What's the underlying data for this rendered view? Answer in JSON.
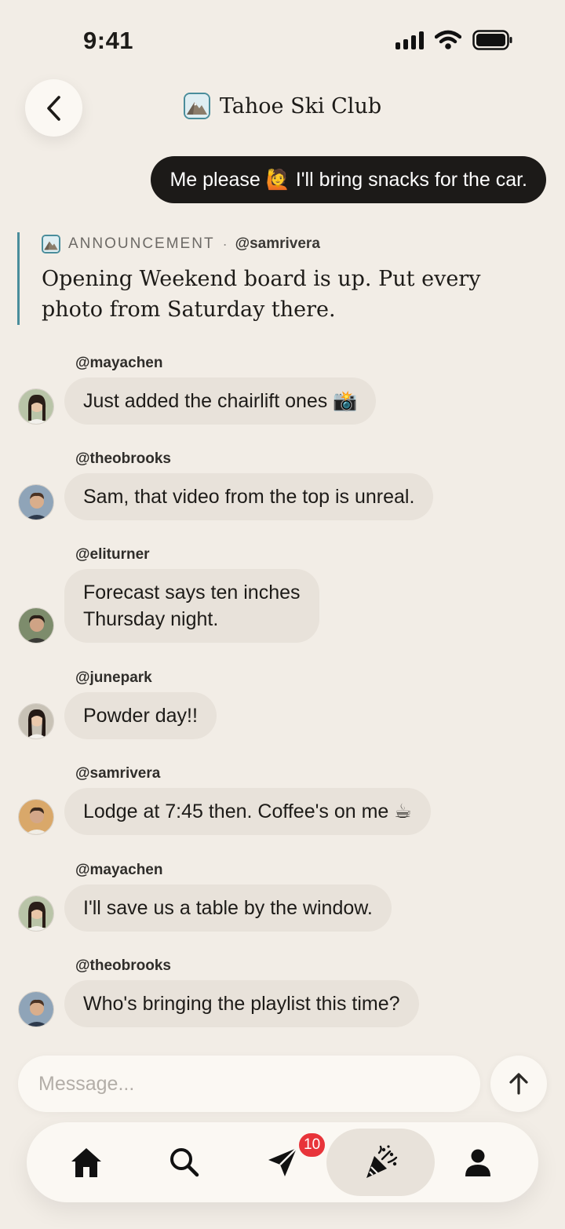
{
  "status_bar": {
    "time": "9:41"
  },
  "header": {
    "title": "Tahoe Ski Club"
  },
  "outgoing_message": {
    "text": "Me please 🙋 I'll bring snacks for the car."
  },
  "announcement": {
    "label": "ANNOUNCEMENT",
    "separator": "·",
    "author": "@samrivera",
    "text": "Opening Weekend board is up. Put every photo from Saturday there."
  },
  "messages": [
    {
      "username": "@mayachen",
      "text": "Just added the chairlift ones 📸"
    },
    {
      "username": "@theobrooks",
      "text": "Sam, that video from the top is unreal."
    },
    {
      "username": "@eliturner",
      "text": "Forecast says ten inches\nThursday night."
    },
    {
      "username": "@junepark",
      "text": "Powder day!!"
    },
    {
      "username": "@samrivera",
      "text": "Lodge at 7:45 then. Coffee's on me ☕"
    },
    {
      "username": "@mayachen",
      "text": "I'll save us a table by the window."
    },
    {
      "username": "@theobrooks",
      "text": "Who's bringing the playlist this time?"
    }
  ],
  "composer": {
    "placeholder": "Message..."
  },
  "tab_bar": {
    "tabs": [
      {
        "icon": "home-icon"
      },
      {
        "icon": "search-icon"
      },
      {
        "icon": "send-icon",
        "badge": "10"
      },
      {
        "icon": "party-popper-icon",
        "active": true
      },
      {
        "icon": "profile-icon"
      }
    ]
  },
  "colors": {
    "background": "#f2ede6",
    "outgoing_bubble": "#1c1a18",
    "incoming_bubble": "#e8e2da",
    "accent": "#4a8d9b",
    "badge": "#e8343a"
  }
}
